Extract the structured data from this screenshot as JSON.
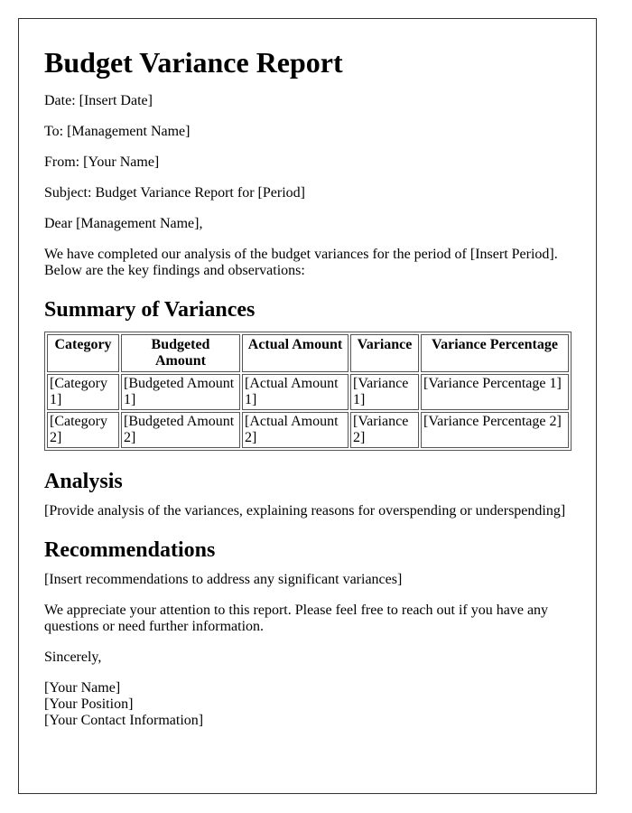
{
  "title": "Budget Variance Report",
  "header": {
    "date": "Date: [Insert Date]",
    "to": "To: [Management Name]",
    "from": "From: [Your Name]",
    "subject": "Subject: Budget Variance Report for [Period]"
  },
  "salutation": "Dear [Management Name],",
  "intro": "We have completed our analysis of the budget variances for the period of [Insert Period]. Below are the key findings and observations:",
  "summary": {
    "heading": "Summary of Variances",
    "columns": [
      "Category",
      "Budgeted Amount",
      "Actual Amount",
      "Variance",
      "Variance Percentage"
    ],
    "rows": [
      [
        "[Category 1]",
        "[Budgeted Amount 1]",
        "[Actual Amount 1]",
        "[Variance 1]",
        "[Variance Percentage 1]"
      ],
      [
        "[Category 2]",
        "[Budgeted Amount 2]",
        "[Actual Amount 2]",
        "[Variance 2]",
        "[Variance Percentage 2]"
      ]
    ]
  },
  "analysis": {
    "heading": "Analysis",
    "text": "[Provide analysis of the variances, explaining reasons for overspending or underspending]"
  },
  "recommendations": {
    "heading": "Recommendations",
    "text": "[Insert recommendations to address any significant variances]"
  },
  "closing": "We appreciate your attention to this report. Please feel free to reach out if you have any questions or need further information.",
  "signoff": "Sincerely,",
  "signature": {
    "name": "[Your Name]",
    "position": "[Your Position]",
    "contact": "[Your Contact Information]"
  }
}
